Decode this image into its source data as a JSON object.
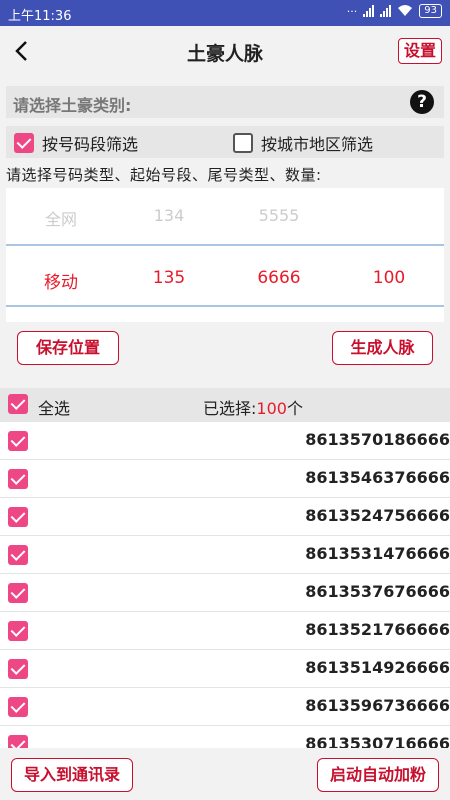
{
  "status_bar": {
    "time": "上午11:36",
    "battery": "93"
  },
  "header": {
    "title": "土豪人脉",
    "settings_label": "设置"
  },
  "category": {
    "placeholder": "请选择土豪类别:"
  },
  "filters": {
    "by_segment_label": "按号码段筛选",
    "by_city_label": "按城市地区筛选"
  },
  "instruction": "请选择号码类型、起始号段、尾号类型、数量:",
  "picker": {
    "top_row": {
      "type": "全网",
      "prefix": "134",
      "suffix": "5555",
      "count": ""
    },
    "selected_row": {
      "type": "移动",
      "prefix": "135",
      "suffix": "6666",
      "count": "100"
    }
  },
  "buttons": {
    "save_position": "保存位置",
    "generate": "生成人脉",
    "import_contacts": "导入到通讯录",
    "auto_add_fans": "启动自动加粉"
  },
  "selection": {
    "select_all_label": "全选",
    "selected_prefix": "已选择:",
    "selected_count": "100",
    "selected_suffix": "个"
  },
  "numbers": [
    "8613570186666",
    "8613546376666",
    "8613524756666",
    "8613531476666",
    "8613537676666",
    "8613521766666",
    "8613514926666",
    "8613596736666",
    "8613530716666"
  ]
}
